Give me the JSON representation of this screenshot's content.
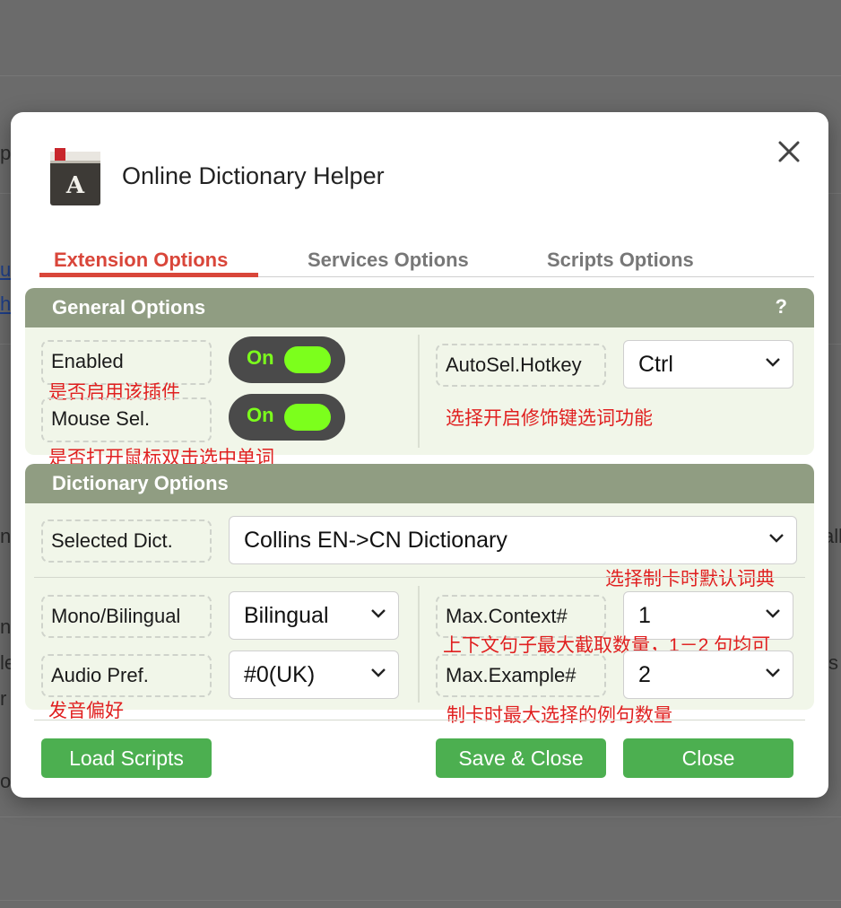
{
  "app": {
    "title": "Online Dictionary Helper",
    "icon_letter": "A"
  },
  "background": {
    "fragments": [
      "p",
      "u",
      "h",
      "n",
      "all",
      "ni",
      "le",
      "s",
      "r",
      "o"
    ]
  },
  "tabs": [
    {
      "label": "Extension Options",
      "active": true
    },
    {
      "label": "Services Options",
      "active": false
    },
    {
      "label": "Scripts Options",
      "active": false
    }
  ],
  "general": {
    "header": "General Options",
    "help": "?",
    "enabled_label": "Enabled",
    "enabled_note": "是否启用该插件",
    "enabled_value": "On",
    "mousesel_label": "Mouse Sel.",
    "mousesel_note": "是否打开鼠标双击选中单词",
    "mousesel_value": "On",
    "hotkey_label": "AutoSel.Hotkey",
    "hotkey_value": "Ctrl",
    "hotkey_note": "选择开启修饰键选词功能"
  },
  "dictionary": {
    "header": "Dictionary Options",
    "selected_label": "Selected Dict.",
    "selected_value": "Collins EN->CN Dictionary",
    "selected_note": "选择制卡时默认词典",
    "mono_label": "Mono/Bilingual",
    "mono_value": "Bilingual",
    "audio_label": "Audio Pref.",
    "audio_value": "#0(UK)",
    "audio_note": "发音偏好",
    "context_label": "Max.Context#",
    "context_value": "1",
    "context_note": "上下文句子最大截取数量，1－2 句均可",
    "example_label": "Max.Example#",
    "example_value": "2",
    "example_note": "制卡时最大选择的例句数量"
  },
  "buttons": {
    "load": "Load Scripts",
    "save": "Save & Close",
    "close": "Close"
  },
  "colors": {
    "accent": "#d9463a",
    "header": "#909d82",
    "panel": "#f1f6e9",
    "toggle_on": "#7cff1c",
    "button": "#4caf50",
    "note": "#e02020"
  }
}
